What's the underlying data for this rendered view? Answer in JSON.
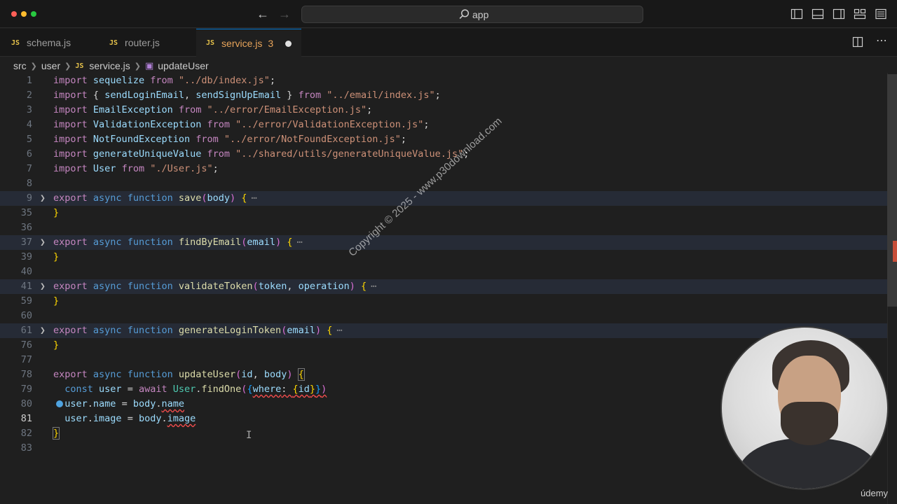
{
  "titlebar": {
    "search_text": "app"
  },
  "tabs": [
    {
      "label": "schema.js",
      "active": false
    },
    {
      "label": "router.js",
      "active": false
    },
    {
      "label": "service.js",
      "active": true,
      "problems": "3",
      "unsaved": true
    }
  ],
  "file_icon_text": "JS",
  "breadcrumb": [
    "src",
    "user",
    "service.js",
    "updateUser"
  ],
  "code_lines": [
    {
      "n": "1"
    },
    {
      "n": "2"
    },
    {
      "n": "3"
    },
    {
      "n": "4"
    },
    {
      "n": "5"
    },
    {
      "n": "6"
    },
    {
      "n": "7"
    },
    {
      "n": "8"
    },
    {
      "n": "9"
    },
    {
      "n": "35"
    },
    {
      "n": "36"
    },
    {
      "n": "37"
    },
    {
      "n": "39"
    },
    {
      "n": "40"
    },
    {
      "n": "41"
    },
    {
      "n": "59"
    },
    {
      "n": "60"
    },
    {
      "n": "61"
    },
    {
      "n": "76"
    },
    {
      "n": "77"
    },
    {
      "n": "78"
    },
    {
      "n": "79"
    },
    {
      "n": "80"
    },
    {
      "n": "81"
    },
    {
      "n": "82"
    },
    {
      "n": "83"
    }
  ],
  "code": {
    "l1": [
      "import",
      "sequelize",
      "from",
      "\"../db/index.js\"",
      ";"
    ],
    "l2": [
      "import",
      "{ ",
      "sendLoginEmail",
      ", ",
      "sendSignUpEmail",
      " }",
      "from",
      "\"../email/index.js\"",
      ";"
    ],
    "l3": [
      "import",
      "EmailException",
      "from",
      "\"../error/EmailException.js\"",
      ";"
    ],
    "l4": [
      "import",
      "ValidationException",
      "from",
      "\"../error/ValidationException.js\"",
      ";"
    ],
    "l5": [
      "import",
      "NotFoundException",
      "from",
      "\"../error/NotFoundException.js\"",
      ";"
    ],
    "l6": [
      "import",
      "generateUniqueValue",
      "from",
      "\"../shared/utils/generateUniqueValue.js\"",
      ";"
    ],
    "l7": [
      "import",
      "User",
      "from",
      "\"./User.js\"",
      ";"
    ],
    "l9": [
      "export",
      "async",
      "function",
      "save",
      "(",
      "body",
      ")",
      "{"
    ],
    "l37": [
      "export",
      "async",
      "function",
      "findByEmail",
      "(",
      "email",
      ")",
      "{"
    ],
    "l41": [
      "export",
      "async",
      "function",
      "validateToken",
      "(",
      "token",
      ", ",
      "operation",
      ")",
      "{"
    ],
    "l61": [
      "export",
      "async",
      "function",
      "generateLoginToken",
      "(",
      "email",
      ")",
      "{"
    ],
    "l78": [
      "export",
      "async",
      "function",
      "updateUser",
      "(",
      "id",
      ", ",
      "body",
      ")",
      "{"
    ],
    "l79": [
      "const",
      "user",
      " = ",
      "await",
      "User",
      ".",
      "findOne",
      "(",
      "{",
      "where",
      ": ",
      "{",
      "id",
      "}",
      "}",
      ")"
    ],
    "l80": [
      "user",
      ".",
      "name",
      " = ",
      "body",
      ".",
      "name"
    ],
    "l81": [
      "user",
      ".",
      "image",
      " = ",
      "body",
      ".",
      "image"
    ],
    "close": "}",
    "fold_ellipsis": "⋯"
  },
  "watermark": "Copyright © 2025 - www.p30download.com",
  "overlay": {
    "brand": "údemy"
  },
  "colors": {
    "accent": "#0078d4",
    "modified_tab": "#e8a45a",
    "error": "#f14c4c"
  }
}
